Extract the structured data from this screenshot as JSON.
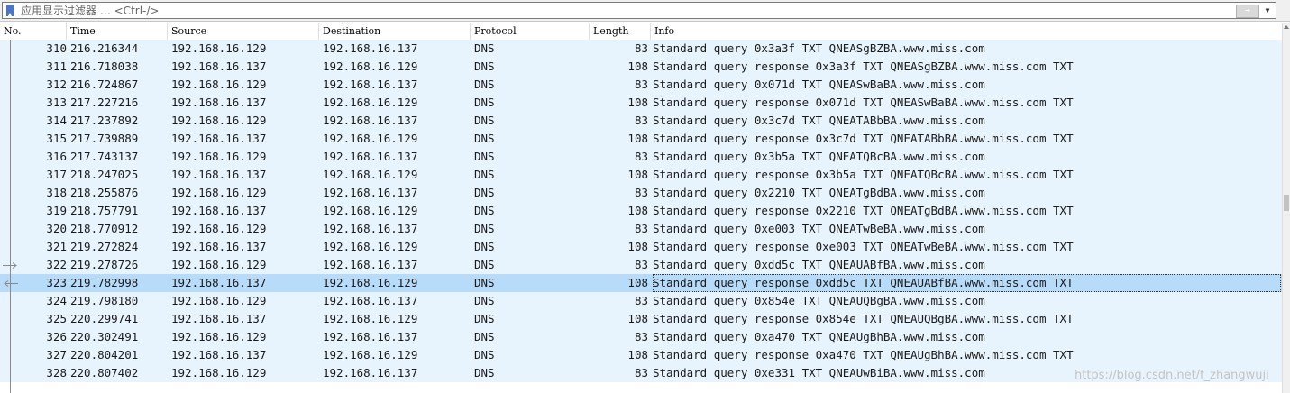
{
  "filter": {
    "placeholder": "应用显示过滤器 … <Ctrl-/>",
    "apply_icon": "arrow-right-icon",
    "dropdown_icon": "chevron-down-icon"
  },
  "columns": [
    "No.",
    "Time",
    "Source",
    "Destination",
    "Protocol",
    "Length",
    "Info"
  ],
  "packets": [
    {
      "no": "310",
      "time": "216.216344",
      "src": "192.168.16.129",
      "dst": "192.168.16.137",
      "proto": "DNS",
      "len": "83",
      "info": "Standard query 0x3a3f TXT QNEASgBZBA.www.miss.com"
    },
    {
      "no": "311",
      "time": "216.718038",
      "src": "192.168.16.137",
      "dst": "192.168.16.129",
      "proto": "DNS",
      "len": "108",
      "info": "Standard query response 0x3a3f TXT QNEASgBZBA.www.miss.com TXT"
    },
    {
      "no": "312",
      "time": "216.724867",
      "src": "192.168.16.129",
      "dst": "192.168.16.137",
      "proto": "DNS",
      "len": "83",
      "info": "Standard query 0x071d TXT QNEASwBaBA.www.miss.com"
    },
    {
      "no": "313",
      "time": "217.227216",
      "src": "192.168.16.137",
      "dst": "192.168.16.129",
      "proto": "DNS",
      "len": "108",
      "info": "Standard query response 0x071d TXT QNEASwBaBA.www.miss.com TXT"
    },
    {
      "no": "314",
      "time": "217.237892",
      "src": "192.168.16.129",
      "dst": "192.168.16.137",
      "proto": "DNS",
      "len": "83",
      "info": "Standard query 0x3c7d TXT QNEATABbBA.www.miss.com"
    },
    {
      "no": "315",
      "time": "217.739889",
      "src": "192.168.16.137",
      "dst": "192.168.16.129",
      "proto": "DNS",
      "len": "108",
      "info": "Standard query response 0x3c7d TXT QNEATABbBA.www.miss.com TXT"
    },
    {
      "no": "316",
      "time": "217.743137",
      "src": "192.168.16.129",
      "dst": "192.168.16.137",
      "proto": "DNS",
      "len": "83",
      "info": "Standard query 0x3b5a TXT QNEATQBcBA.www.miss.com"
    },
    {
      "no": "317",
      "time": "218.247025",
      "src": "192.168.16.137",
      "dst": "192.168.16.129",
      "proto": "DNS",
      "len": "108",
      "info": "Standard query response 0x3b5a TXT QNEATQBcBA.www.miss.com TXT"
    },
    {
      "no": "318",
      "time": "218.255876",
      "src": "192.168.16.129",
      "dst": "192.168.16.137",
      "proto": "DNS",
      "len": "83",
      "info": "Standard query 0x2210 TXT QNEATgBdBA.www.miss.com"
    },
    {
      "no": "319",
      "time": "218.757791",
      "src": "192.168.16.137",
      "dst": "192.168.16.129",
      "proto": "DNS",
      "len": "108",
      "info": "Standard query response 0x2210 TXT QNEATgBdBA.www.miss.com TXT"
    },
    {
      "no": "320",
      "time": "218.770912",
      "src": "192.168.16.129",
      "dst": "192.168.16.137",
      "proto": "DNS",
      "len": "83",
      "info": "Standard query 0xe003 TXT QNEATwBeBA.www.miss.com"
    },
    {
      "no": "321",
      "time": "219.272824",
      "src": "192.168.16.137",
      "dst": "192.168.16.129",
      "proto": "DNS",
      "len": "108",
      "info": "Standard query response 0xe003 TXT QNEATwBeBA.www.miss.com TXT"
    },
    {
      "no": "322",
      "time": "219.278726",
      "src": "192.168.16.129",
      "dst": "192.168.16.137",
      "proto": "DNS",
      "len": "83",
      "info": "Standard query 0xdd5c TXT QNEAUABfBA.www.miss.com",
      "marker": "request-arrow-icon"
    },
    {
      "no": "323",
      "time": "219.782998",
      "src": "192.168.16.137",
      "dst": "192.168.16.129",
      "proto": "DNS",
      "len": "108",
      "info": "Standard query response 0xdd5c TXT QNEAUABfBA.www.miss.com TXT",
      "marker": "response-arrow-icon",
      "selected": true
    },
    {
      "no": "324",
      "time": "219.798180",
      "src": "192.168.16.129",
      "dst": "192.168.16.137",
      "proto": "DNS",
      "len": "83",
      "info": "Standard query 0x854e TXT QNEAUQBgBA.www.miss.com"
    },
    {
      "no": "325",
      "time": "220.299741",
      "src": "192.168.16.137",
      "dst": "192.168.16.129",
      "proto": "DNS",
      "len": "108",
      "info": "Standard query response 0x854e TXT QNEAUQBgBA.www.miss.com TXT"
    },
    {
      "no": "326",
      "time": "220.302491",
      "src": "192.168.16.129",
      "dst": "192.168.16.137",
      "proto": "DNS",
      "len": "83",
      "info": "Standard query 0xa470 TXT QNEAUgBhBA.www.miss.com"
    },
    {
      "no": "327",
      "time": "220.804201",
      "src": "192.168.16.137",
      "dst": "192.168.16.129",
      "proto": "DNS",
      "len": "108",
      "info": "Standard query response 0xa470 TXT QNEAUgBhBA.www.miss.com TXT"
    },
    {
      "no": "328",
      "time": "220.807402",
      "src": "192.168.16.129",
      "dst": "192.168.16.137",
      "proto": "DNS",
      "len": "83",
      "info": "Standard query 0xe331 TXT QNEAUwBiBA.www.miss.com"
    }
  ],
  "colors": {
    "row_bg": "#e7f4fe",
    "selected_bg": "#b7dcfa"
  },
  "watermark": "https://blog.csdn.net/f_zhangwuji"
}
